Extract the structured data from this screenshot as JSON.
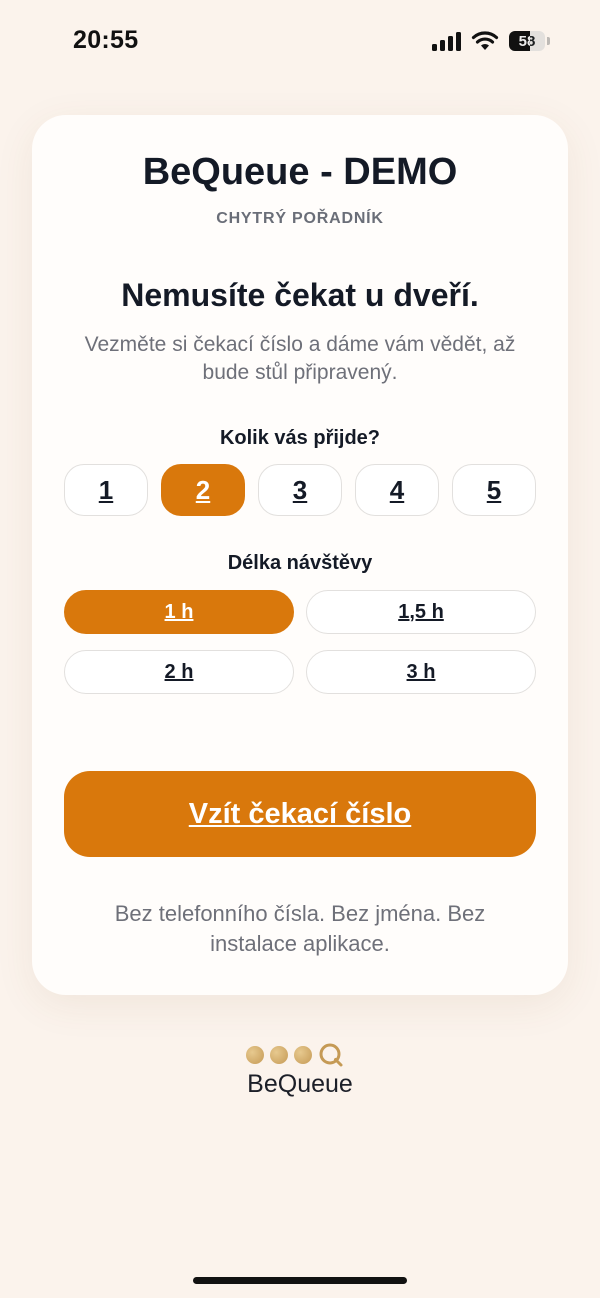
{
  "status_bar": {
    "time": "20:55",
    "battery": "58",
    "icons": [
      "signal-icon",
      "wifi-icon",
      "battery-icon"
    ]
  },
  "card": {
    "title": "BeQueue - DEMO",
    "subtitle": "CHYTRÝ POŘADNÍK",
    "headline": "Nemusíte čekat u dveří.",
    "lead": "Vezměte si čekací číslo a dáme vám vědět, až bude stůl připravený.",
    "party_label": "Kolik vás přijde?",
    "party_sizes": [
      "1",
      "2",
      "3",
      "4",
      "5"
    ],
    "party_selected": "2",
    "duration_label": "Délka návštěvy",
    "durations": [
      "1 h",
      "1,5 h",
      "2 h",
      "3 h"
    ],
    "duration_selected": "1 h",
    "cta_label": "Vzít čekací číslo",
    "note": "Bez telefonního čísla. Bez jména. Bez instalace aplikace."
  },
  "logo": {
    "text": "BeQueue"
  },
  "colors": {
    "accent": "#d9780c",
    "background": "#fbf3ec",
    "card": "#fffdfb",
    "text": "#141a26",
    "muted": "#6e7079",
    "logo_gold": "#c59a55"
  }
}
